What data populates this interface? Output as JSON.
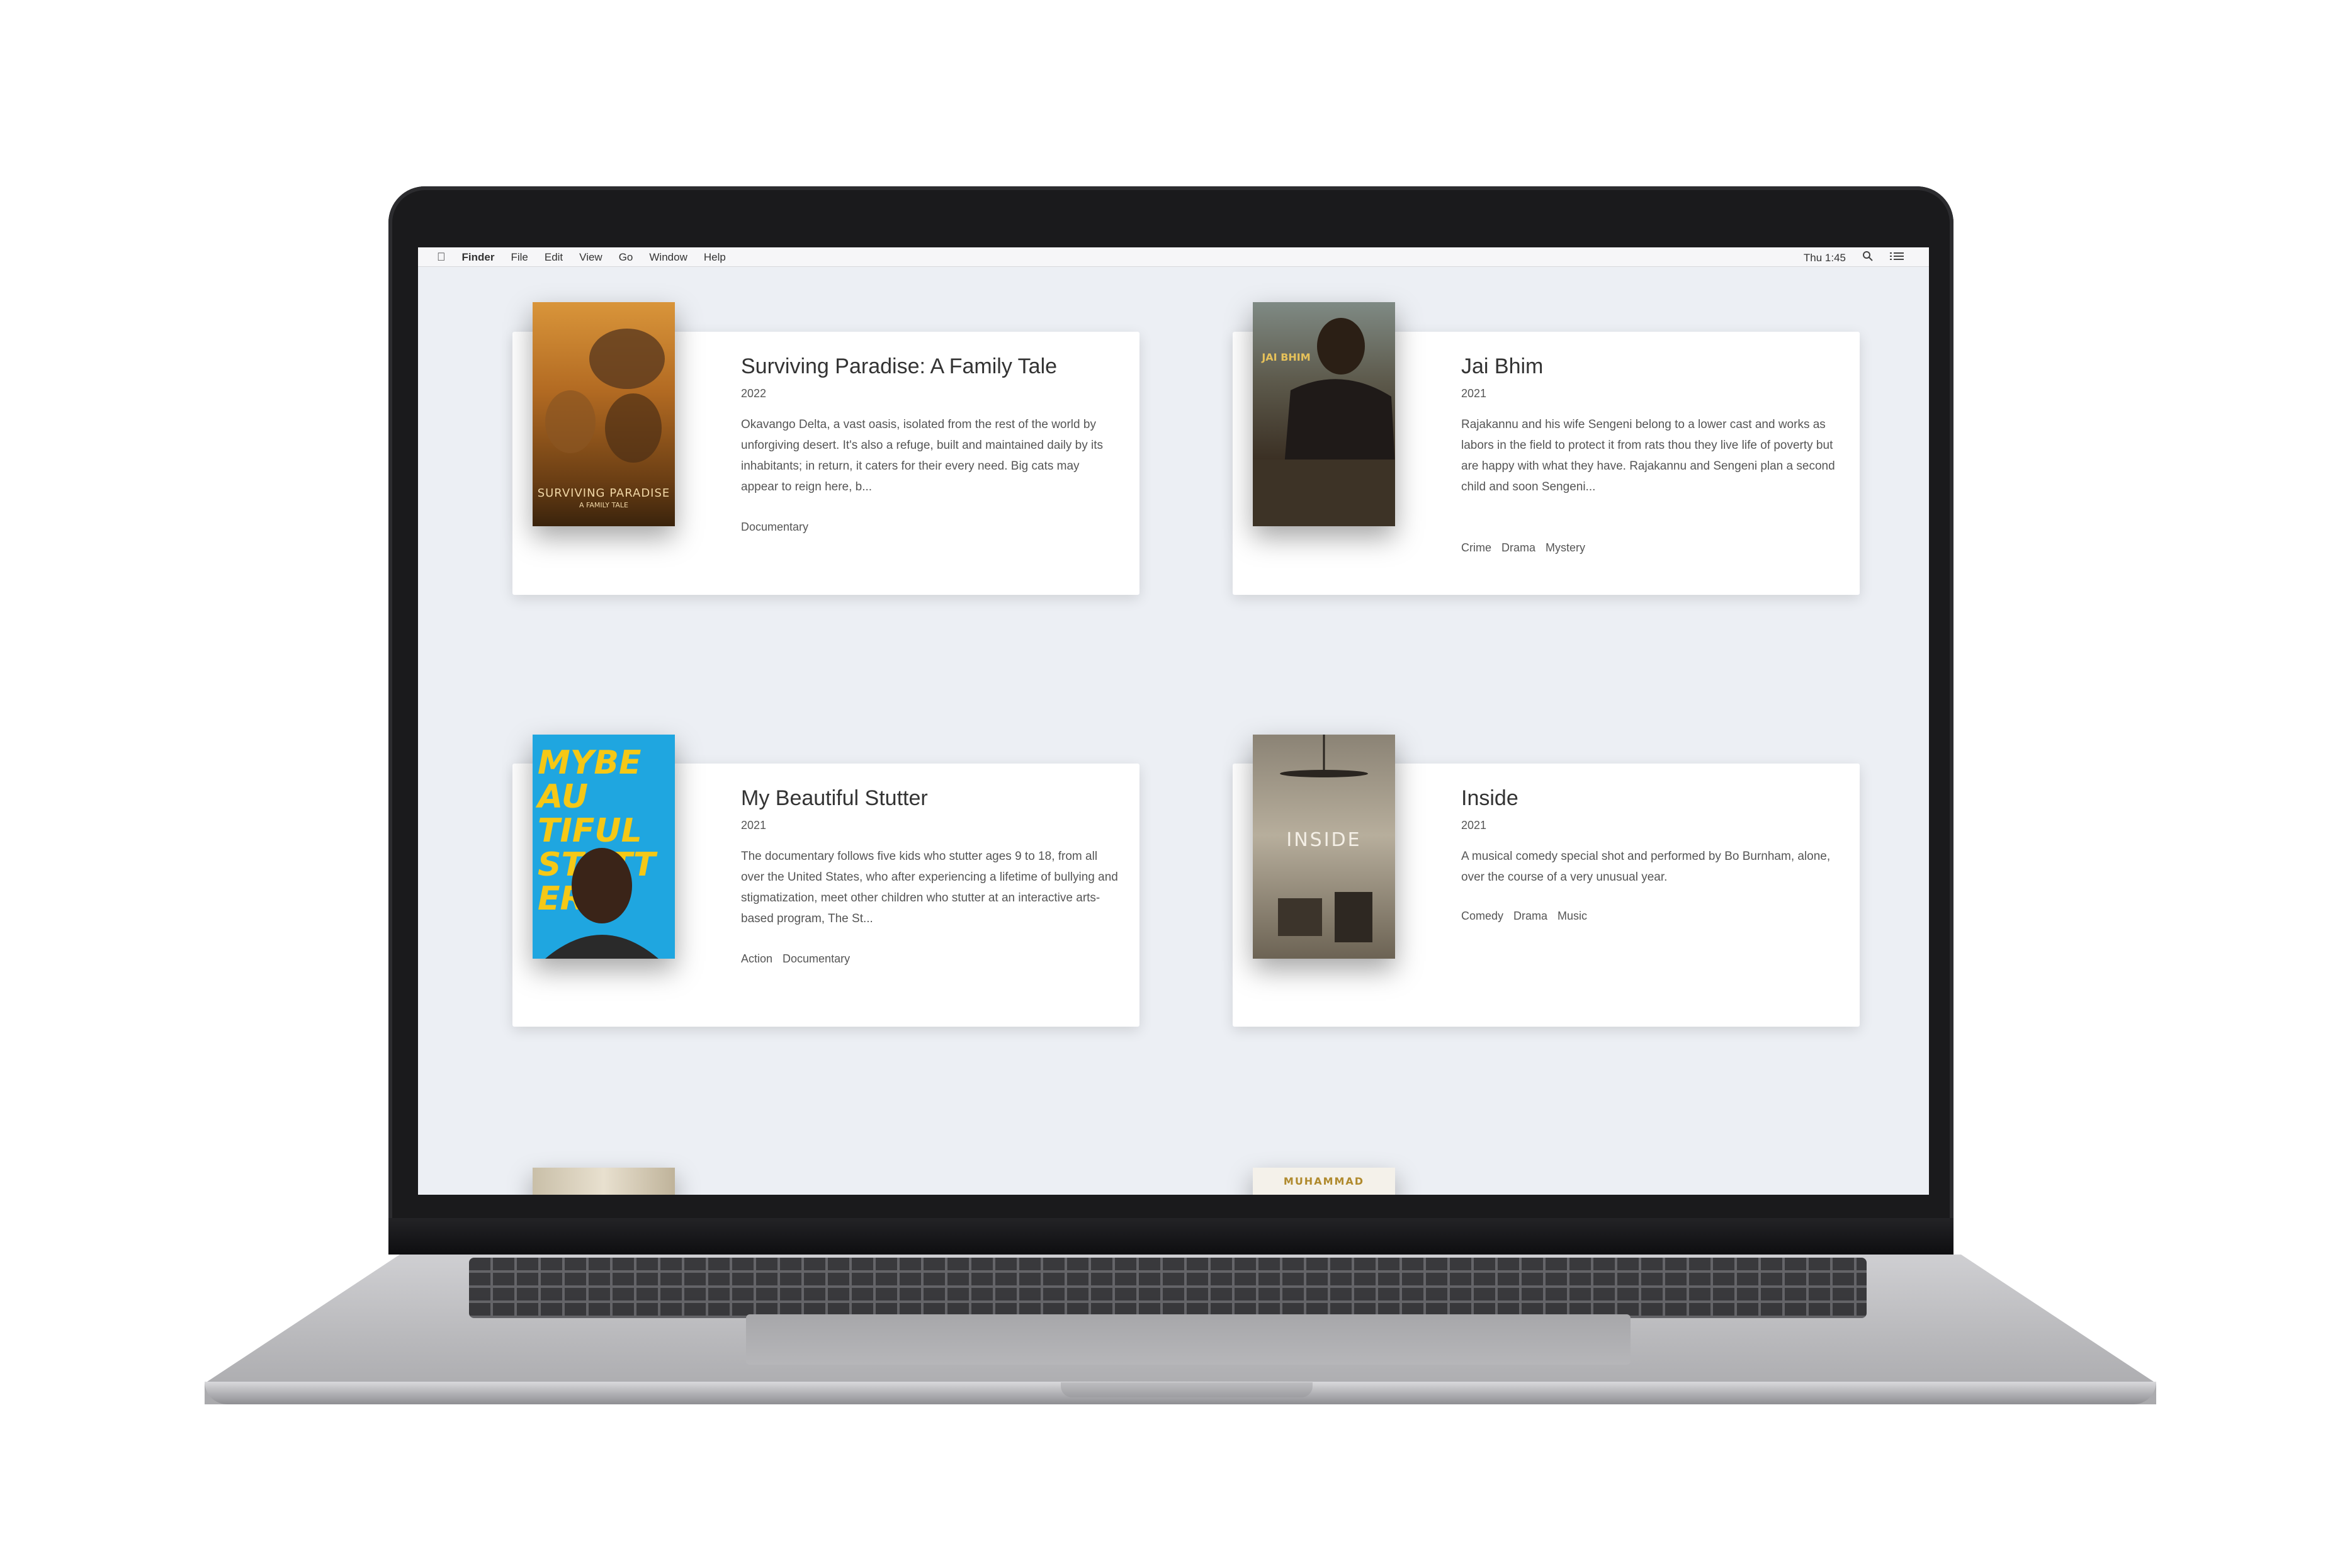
{
  "menubar": {
    "app": "Finder",
    "items": [
      "File",
      "Edit",
      "View",
      "Go",
      "Window",
      "Help"
    ],
    "clock": "Thu 1:45"
  },
  "movies": [
    {
      "title": "Surviving Paradise: A Family Tale",
      "year": "2022",
      "description": "Okavango Delta, a vast oasis, isolated from the rest of the world by unforgiving desert. It's also a refuge, built and maintained daily by its inhabitants; in return, it caters for their every need. Big cats may appear to reign here, b...",
      "genres": [
        "Documentary"
      ],
      "poster_text": "SURVIVING PARADISE",
      "poster_subtext": "A FAMILY TALE"
    },
    {
      "title": "Jai Bhim",
      "year": "2021",
      "description": "Rajakannu and his wife Sengeni belong to a lower cast and works as labors in the field to protect it from rats thou they live life of poverty but are happy with what they have. Rajakannu and Sengeni plan a second child and soon Sengeni...",
      "genres": [
        "Crime",
        "Drama",
        "Mystery"
      ],
      "poster_text": "JAI BHIM"
    },
    {
      "title": "My Beautiful Stutter",
      "year": "2021",
      "description": "The documentary follows five kids who stutter ages 9 to 18, from all over the United States, who after experiencing a lifetime of bullying and stigmatization, meet other children who stutter at an interactive arts-based program, The St...",
      "genres": [
        "Action",
        "Documentary"
      ],
      "poster_text": "MYBEAU TIFUL STUTT ER"
    },
    {
      "title": "Inside",
      "year": "2021",
      "description": "A musical comedy special shot and performed by Bo Burnham, alone, over the course of a very unusual year.",
      "genres": [
        "Comedy",
        "Drama",
        "Music"
      ],
      "poster_text": "INSIDE"
    }
  ],
  "partial_posters": {
    "right_text": "MUHAMMAD"
  },
  "colors": {
    "screen_bg": "#eceff4",
    "card_bg": "#ffffff",
    "stutter_poster": "#1fa6e0",
    "stutter_text": "#f5c816"
  },
  "icons": [
    "apple-icon",
    "search-icon",
    "list-icon"
  ]
}
